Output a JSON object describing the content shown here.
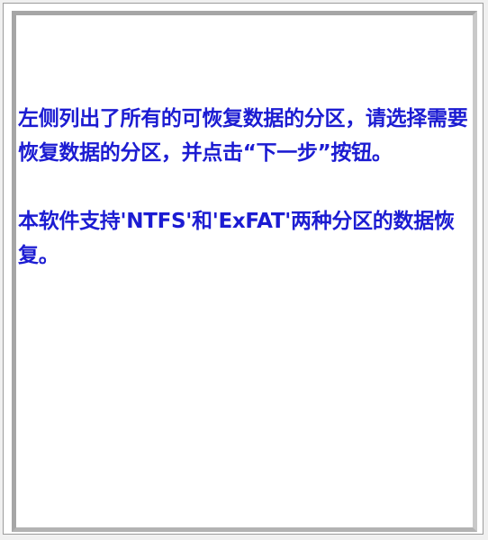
{
  "instructions": {
    "paragraph1": "左侧列出了所有的可恢复数据的分区，请选择需要恢复数据的分区，并点击“下一步”按钮。",
    "paragraph2": "本软件支持'NTFS'和'ExFAT'两种分区的数据恢复。"
  },
  "colors": {
    "text": "#1c1cd2",
    "panel_border": "#a6a6a6",
    "background": "#ffffff"
  }
}
